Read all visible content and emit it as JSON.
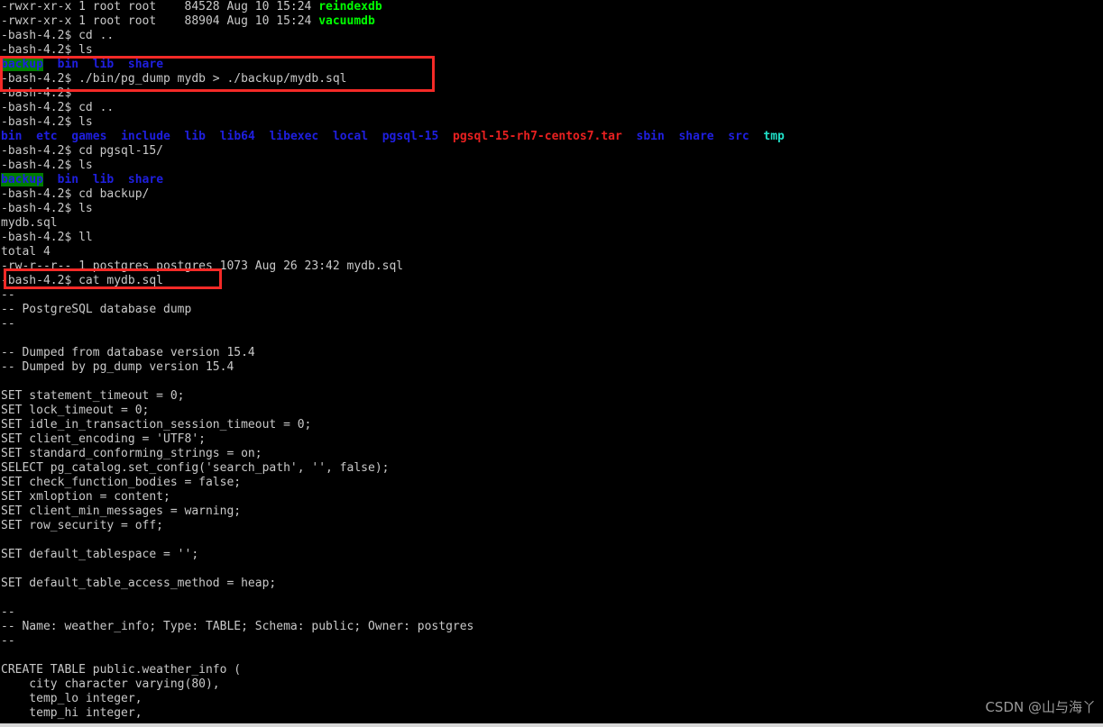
{
  "terminal": {
    "shell_prompt": "-bash-4.2$",
    "background_color": "#000000",
    "foreground_color": "#c9c9c9",
    "colors": {
      "executable_green": "#00ff00",
      "directory_blue": "#1f1fe0",
      "archive_red": "#e82020",
      "sticky_cyan": "#20e0c8",
      "other_writable_dir_bg": "#007d00",
      "annotation_red": "#f42a27",
      "watermark_gray": "#9a9a9a"
    },
    "lines": [
      {
        "id": "ls-reindexdb",
        "segments": [
          {
            "text": "-rwxr-xr-x 1 root root    84528 Aug 10 15:24 ",
            "style": "c-default"
          },
          {
            "text": "reindexdb",
            "style": "c-exec"
          }
        ]
      },
      {
        "id": "ls-vacuumdb",
        "segments": [
          {
            "text": "-rwxr-xr-x 1 root root    88904 Aug 10 15:24 ",
            "style": "c-default"
          },
          {
            "text": "vacuumdb",
            "style": "c-exec"
          }
        ]
      },
      {
        "id": "cmd-cd-up-1",
        "segments": [
          {
            "text": "-bash-4.2$ cd ..",
            "style": "c-default"
          }
        ]
      },
      {
        "id": "cmd-ls-1",
        "segments": [
          {
            "text": "-bash-4.2$ ls",
            "style": "c-default"
          }
        ]
      },
      {
        "id": "ls-pgsql-contents-1",
        "segments": [
          {
            "text": "backup",
            "style": "c-ow-dir"
          },
          {
            "text": "  ",
            "style": "c-default"
          },
          {
            "text": "bin",
            "style": "c-dir"
          },
          {
            "text": "  ",
            "style": "c-default"
          },
          {
            "text": "lib",
            "style": "c-dir"
          },
          {
            "text": "  ",
            "style": "c-default"
          },
          {
            "text": "share",
            "style": "c-dir"
          }
        ]
      },
      {
        "id": "cmd-pg-dump",
        "segments": [
          {
            "text": "-bash-4.2$ ./bin/pg_dump mydb > ./backup/mydb.sql",
            "style": "c-default"
          }
        ]
      },
      {
        "id": "prompt-after-dump",
        "segments": [
          {
            "text": "-bash-4.2$",
            "style": "c-default"
          }
        ]
      },
      {
        "id": "cmd-cd-up-2",
        "segments": [
          {
            "text": "-bash-4.2$ cd ..",
            "style": "c-default"
          }
        ]
      },
      {
        "id": "cmd-ls-2",
        "segments": [
          {
            "text": "-bash-4.2$ ls",
            "style": "c-default"
          }
        ]
      },
      {
        "id": "ls-usr-contents",
        "segments": [
          {
            "text": "bin",
            "style": "c-dir"
          },
          {
            "text": "  ",
            "style": "c-default"
          },
          {
            "text": "etc",
            "style": "c-dir"
          },
          {
            "text": "  ",
            "style": "c-default"
          },
          {
            "text": "games",
            "style": "c-dir"
          },
          {
            "text": "  ",
            "style": "c-default"
          },
          {
            "text": "include",
            "style": "c-dir"
          },
          {
            "text": "  ",
            "style": "c-default"
          },
          {
            "text": "lib",
            "style": "c-dir"
          },
          {
            "text": "  ",
            "style": "c-default"
          },
          {
            "text": "lib64",
            "style": "c-dir"
          },
          {
            "text": "  ",
            "style": "c-default"
          },
          {
            "text": "libexec",
            "style": "c-dir"
          },
          {
            "text": "  ",
            "style": "c-default"
          },
          {
            "text": "local",
            "style": "c-dir"
          },
          {
            "text": "  ",
            "style": "c-default"
          },
          {
            "text": "pgsql-15",
            "style": "c-dir"
          },
          {
            "text": "  ",
            "style": "c-default"
          },
          {
            "text": "pgsql-15-rh7-centos7.tar",
            "style": "c-archive"
          },
          {
            "text": "  ",
            "style": "c-default"
          },
          {
            "text": "sbin",
            "style": "c-dir"
          },
          {
            "text": "  ",
            "style": "c-default"
          },
          {
            "text": "share",
            "style": "c-dir"
          },
          {
            "text": "  ",
            "style": "c-default"
          },
          {
            "text": "src",
            "style": "c-dir"
          },
          {
            "text": "  ",
            "style": "c-default"
          },
          {
            "text": "tmp",
            "style": "c-sticky"
          }
        ]
      },
      {
        "id": "cmd-cd-pgsql",
        "segments": [
          {
            "text": "-bash-4.2$ cd pgsql-15/",
            "style": "c-default"
          }
        ]
      },
      {
        "id": "cmd-ls-3",
        "segments": [
          {
            "text": "-bash-4.2$ ls",
            "style": "c-default"
          }
        ]
      },
      {
        "id": "ls-pgsql-contents-2",
        "segments": [
          {
            "text": "backup",
            "style": "c-ow-dir"
          },
          {
            "text": "  ",
            "style": "c-default"
          },
          {
            "text": "bin",
            "style": "c-dir"
          },
          {
            "text": "  ",
            "style": "c-default"
          },
          {
            "text": "lib",
            "style": "c-dir"
          },
          {
            "text": "  ",
            "style": "c-default"
          },
          {
            "text": "share",
            "style": "c-dir"
          }
        ]
      },
      {
        "id": "cmd-cd-backup",
        "segments": [
          {
            "text": "-bash-4.2$ cd backup/",
            "style": "c-default"
          }
        ]
      },
      {
        "id": "cmd-ls-4",
        "segments": [
          {
            "text": "-bash-4.2$ ls",
            "style": "c-default"
          }
        ]
      },
      {
        "id": "ls-backup-contents",
        "segments": [
          {
            "text": "mydb.sql",
            "style": "c-default"
          }
        ]
      },
      {
        "id": "cmd-ll",
        "segments": [
          {
            "text": "-bash-4.2$ ll",
            "style": "c-default"
          }
        ]
      },
      {
        "id": "ll-total",
        "segments": [
          {
            "text": "total 4",
            "style": "c-default"
          }
        ]
      },
      {
        "id": "ll-mydb-sql",
        "segments": [
          {
            "text": "-rw-r--r-- 1 postgres postgres 1073 Aug 26 23:42 mydb.sql",
            "style": "c-default"
          }
        ]
      },
      {
        "id": "cmd-cat-mydb",
        "segments": [
          {
            "text": "-bash-4.2$ cat mydb.sql",
            "style": "c-default"
          }
        ]
      },
      {
        "id": "sql-dash-1",
        "segments": [
          {
            "text": "--",
            "style": "c-default"
          }
        ]
      },
      {
        "id": "sql-header-title",
        "segments": [
          {
            "text": "-- PostgreSQL database dump",
            "style": "c-default"
          }
        ]
      },
      {
        "id": "sql-dash-2",
        "segments": [
          {
            "text": "--",
            "style": "c-default"
          }
        ]
      },
      {
        "id": "sql-blank-1",
        "segments": [
          {
            "text": "",
            "style": "c-default"
          }
        ]
      },
      {
        "id": "sql-dumped-from",
        "segments": [
          {
            "text": "-- Dumped from database version 15.4",
            "style": "c-default"
          }
        ]
      },
      {
        "id": "sql-dumped-by",
        "segments": [
          {
            "text": "-- Dumped by pg_dump version 15.4",
            "style": "c-default"
          }
        ]
      },
      {
        "id": "sql-blank-2",
        "segments": [
          {
            "text": "",
            "style": "c-default"
          }
        ]
      },
      {
        "id": "sql-set-statement-timeout",
        "segments": [
          {
            "text": "SET statement_timeout = 0;",
            "style": "c-default"
          }
        ]
      },
      {
        "id": "sql-set-lock-timeout",
        "segments": [
          {
            "text": "SET lock_timeout = 0;",
            "style": "c-default"
          }
        ]
      },
      {
        "id": "sql-set-idle-timeout",
        "segments": [
          {
            "text": "SET idle_in_transaction_session_timeout = 0;",
            "style": "c-default"
          }
        ]
      },
      {
        "id": "sql-set-client-encoding",
        "segments": [
          {
            "text": "SET client_encoding = 'UTF8';",
            "style": "c-default"
          }
        ]
      },
      {
        "id": "sql-set-standard-strings",
        "segments": [
          {
            "text": "SET standard_conforming_strings = on;",
            "style": "c-default"
          }
        ]
      },
      {
        "id": "sql-select-set-config",
        "segments": [
          {
            "text": "SELECT pg_catalog.set_config('search_path', '', false);",
            "style": "c-default"
          }
        ]
      },
      {
        "id": "sql-set-check-function-bodies",
        "segments": [
          {
            "text": "SET check_function_bodies = false;",
            "style": "c-default"
          }
        ]
      },
      {
        "id": "sql-set-xmloption",
        "segments": [
          {
            "text": "SET xmloption = content;",
            "style": "c-default"
          }
        ]
      },
      {
        "id": "sql-set-client-min-messages",
        "segments": [
          {
            "text": "SET client_min_messages = warning;",
            "style": "c-default"
          }
        ]
      },
      {
        "id": "sql-set-row-security",
        "segments": [
          {
            "text": "SET row_security = off;",
            "style": "c-default"
          }
        ]
      },
      {
        "id": "sql-blank-3",
        "segments": [
          {
            "text": "",
            "style": "c-default"
          }
        ]
      },
      {
        "id": "sql-set-default-tablespace",
        "segments": [
          {
            "text": "SET default_tablespace = '';",
            "style": "c-default"
          }
        ]
      },
      {
        "id": "sql-blank-4",
        "segments": [
          {
            "text": "",
            "style": "c-default"
          }
        ]
      },
      {
        "id": "sql-set-default-table-access",
        "segments": [
          {
            "text": "SET default_table_access_method = heap;",
            "style": "c-default"
          }
        ]
      },
      {
        "id": "sql-blank-5",
        "segments": [
          {
            "text": "",
            "style": "c-default"
          }
        ]
      },
      {
        "id": "sql-dash-3",
        "segments": [
          {
            "text": "--",
            "style": "c-default"
          }
        ]
      },
      {
        "id": "sql-object-comment",
        "segments": [
          {
            "text": "-- Name: weather_info; Type: TABLE; Schema: public; Owner: postgres",
            "style": "c-default"
          }
        ]
      },
      {
        "id": "sql-dash-4",
        "segments": [
          {
            "text": "--",
            "style": "c-default"
          }
        ]
      },
      {
        "id": "sql-blank-6",
        "segments": [
          {
            "text": "",
            "style": "c-default"
          }
        ]
      },
      {
        "id": "sql-create-table",
        "segments": [
          {
            "text": "CREATE TABLE public.weather_info (",
            "style": "c-default"
          }
        ]
      },
      {
        "id": "sql-col-city",
        "segments": [
          {
            "text": "    city character varying(80),",
            "style": "c-default"
          }
        ]
      },
      {
        "id": "sql-col-temp-lo",
        "segments": [
          {
            "text": "    temp_lo integer,",
            "style": "c-default"
          }
        ]
      },
      {
        "id": "sql-col-temp-hi",
        "segments": [
          {
            "text": "    temp_hi integer,",
            "style": "c-default"
          }
        ]
      }
    ]
  },
  "annotations": [
    {
      "id": "annot-dump-cmd",
      "target": "pg_dump backup command"
    },
    {
      "id": "annot-cat-cmd",
      "target": "cat mydb.sql command"
    }
  ],
  "watermark": {
    "text": "CSDN @山与海丫"
  }
}
